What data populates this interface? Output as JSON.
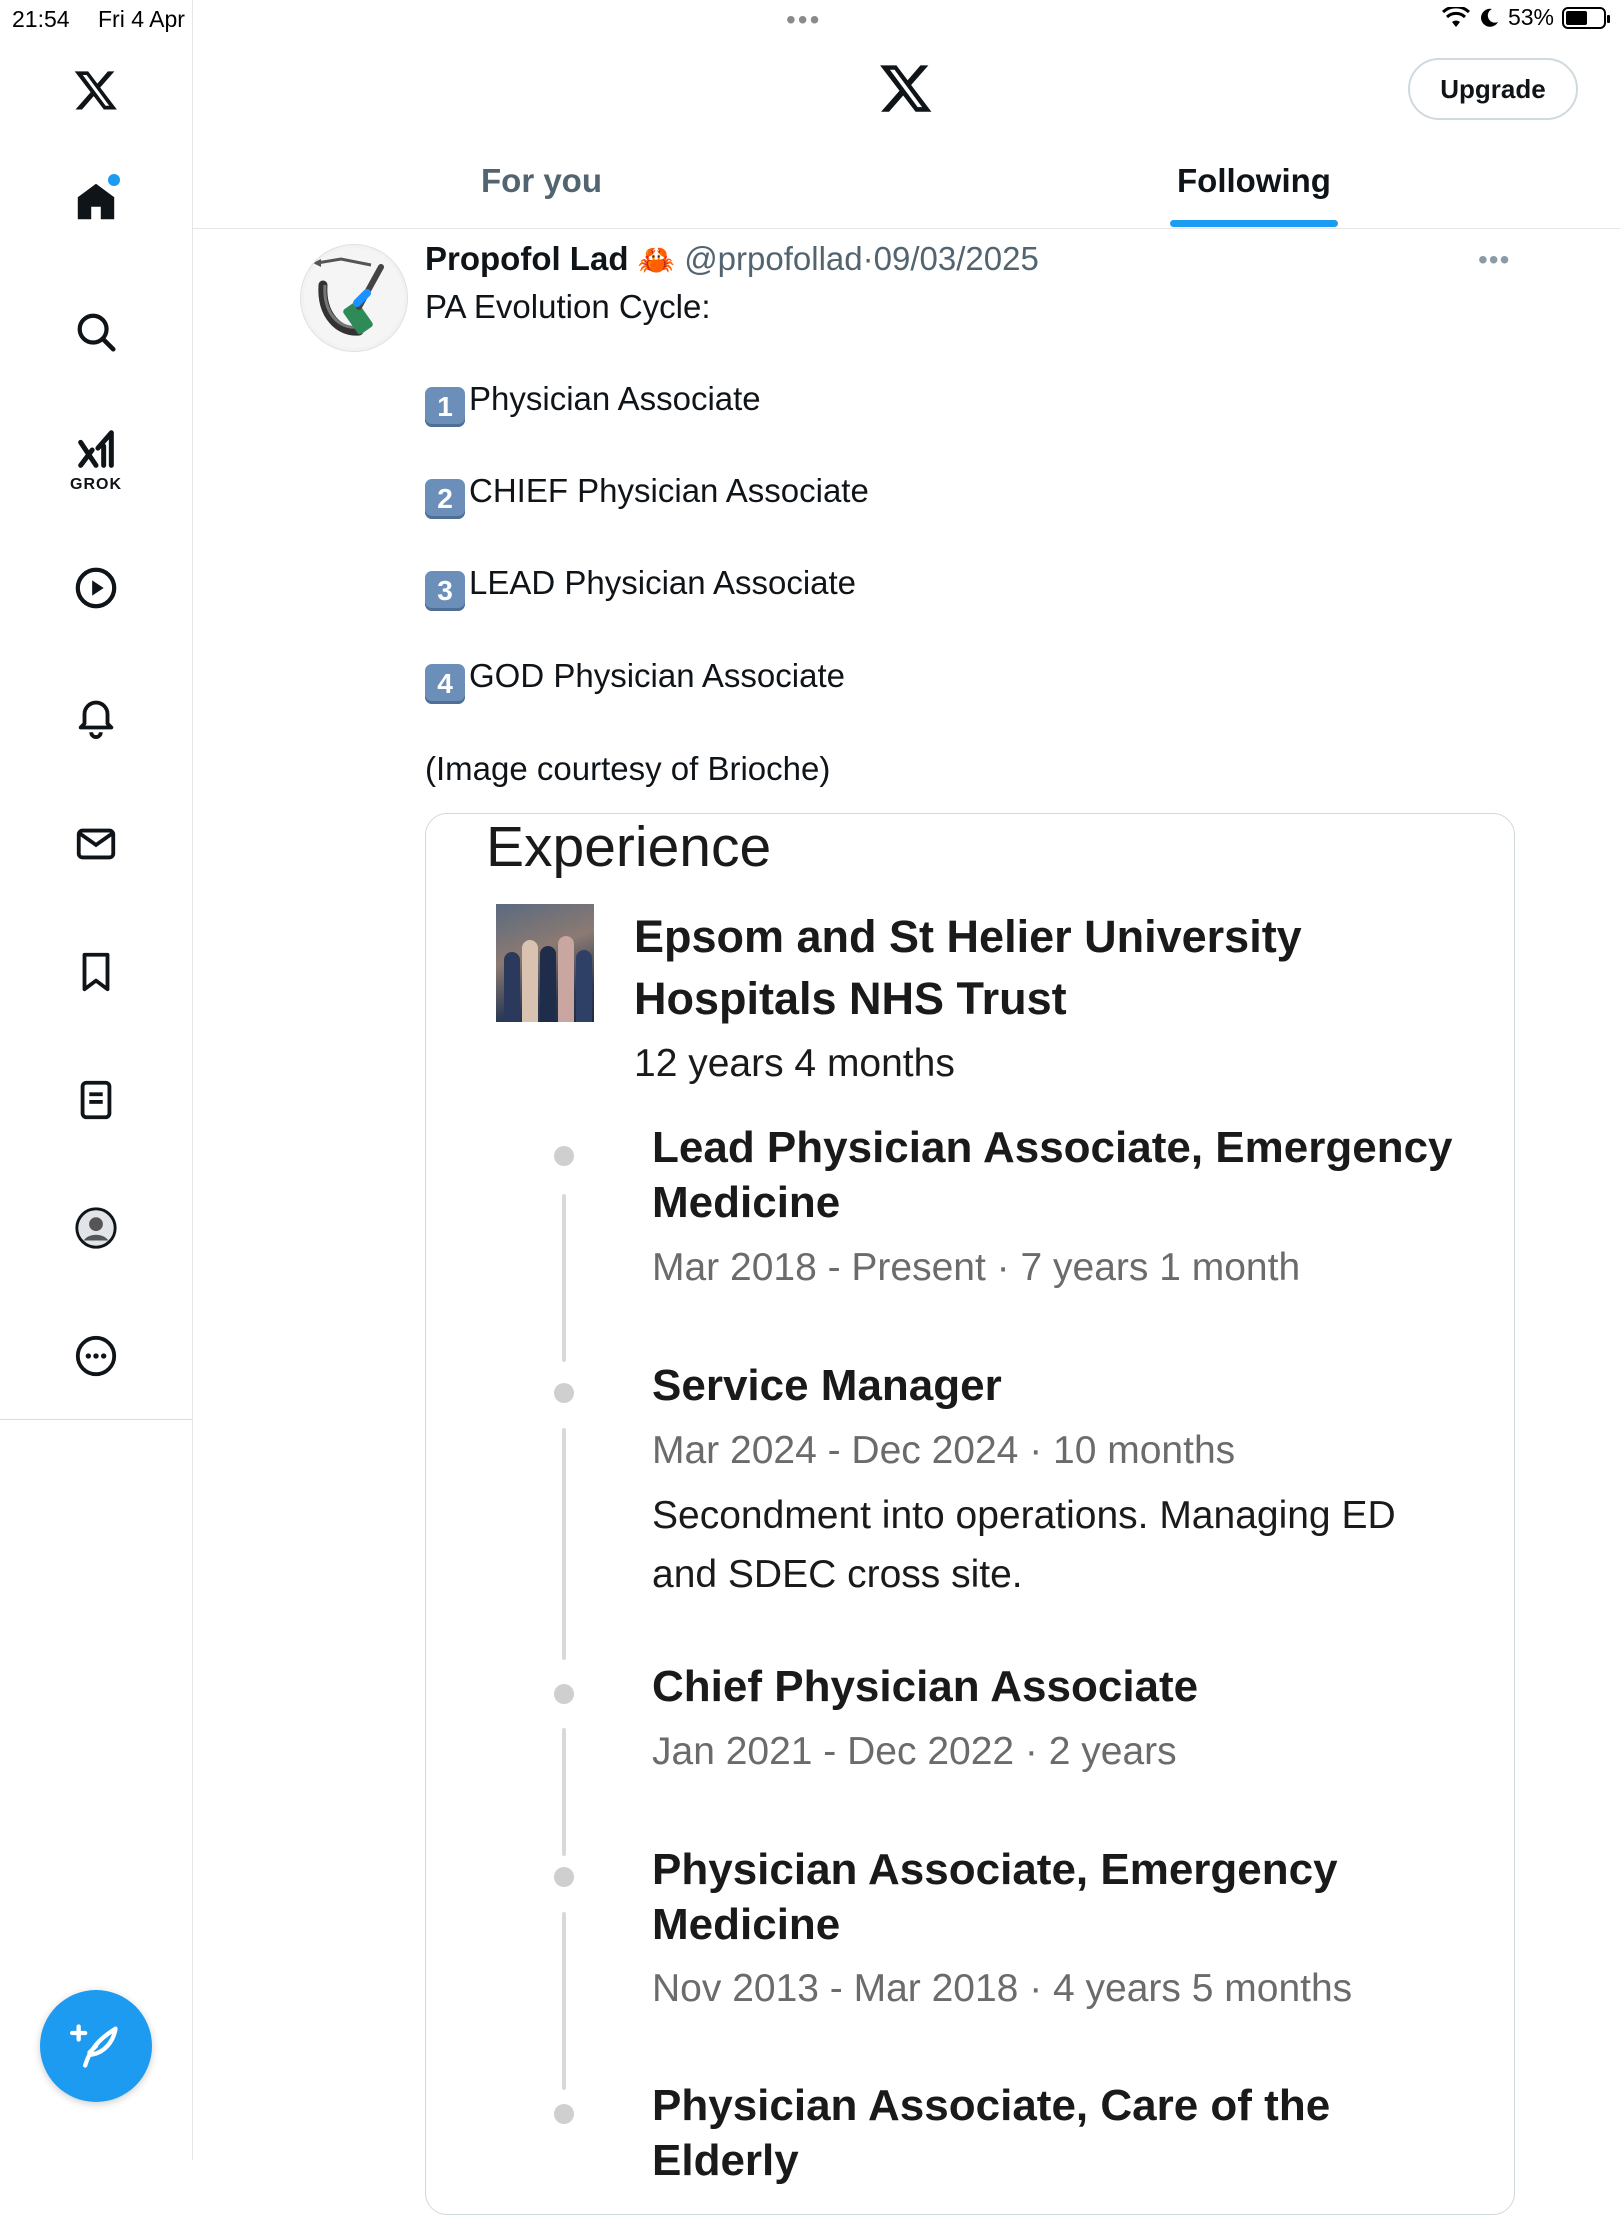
{
  "status_bar": {
    "time": "21:54",
    "date": "Fri 4 Apr",
    "battery": "53%",
    "battery_level": 0.53
  },
  "sidebar": {
    "items": [
      {
        "icon": "x-logo-icon"
      },
      {
        "icon": "home-icon",
        "has_notification_dot": true
      },
      {
        "icon": "search-icon"
      },
      {
        "icon": "grok-icon",
        "label": "GROK"
      },
      {
        "icon": "play-icon"
      },
      {
        "icon": "bell-icon"
      },
      {
        "icon": "mail-icon"
      },
      {
        "icon": "bookmark-icon"
      },
      {
        "icon": "list-icon"
      },
      {
        "icon": "profile-icon"
      },
      {
        "icon": "more-icon"
      }
    ],
    "compose_icon": "compose-icon"
  },
  "header": {
    "upgrade_label": "Upgrade",
    "tabs": [
      {
        "label": "For you",
        "active": false
      },
      {
        "label": "Following",
        "active": true
      }
    ]
  },
  "tweet": {
    "author_name": "Propofol Lad",
    "author_emoji": "🦀",
    "handle": "@prpofollad",
    "separator": "·",
    "date": "09/03/2025",
    "lines": {
      "intro": "PA Evolution Cycle:",
      "item1_num": "1",
      "item1": "Physician Associate",
      "item2_num": "2",
      "item2": "CHIEF Physician Associate",
      "item3_num": "3",
      "item3": "LEAD Physician Associate",
      "item4_num": "4",
      "item4": "GOD Physician Associate",
      "credit": "(Image courtesy of Brioche)"
    },
    "image": {
      "section_title": "Experience",
      "org_name": "Epsom and St Helier University Hospitals NHS Trust",
      "org_duration": "12 years 4 months",
      "roles": [
        {
          "title": "Lead Physician Associate, Emergency Medicine",
          "dates": "Mar 2018 - Present  · 7 years 1 month"
        },
        {
          "title": "Service Manager",
          "dates": "Mar 2024 - Dec 2024  · 10 months",
          "description": "Secondment into operations. Managing ED and SDEC cross site."
        },
        {
          "title": "Chief Physician Associate",
          "dates": "Jan 2021 - Dec 2022  · 2 years"
        },
        {
          "title": "Physician Associate, Emergency Medicine",
          "dates": "Nov 2013 - Mar 2018  · 4 years 5 months"
        },
        {
          "title": "Physician Associate, Care of the Elderly"
        }
      ]
    }
  },
  "colors": {
    "accent": "#1d9bf0",
    "text": "#0f1419",
    "secondary_text": "#536471"
  }
}
